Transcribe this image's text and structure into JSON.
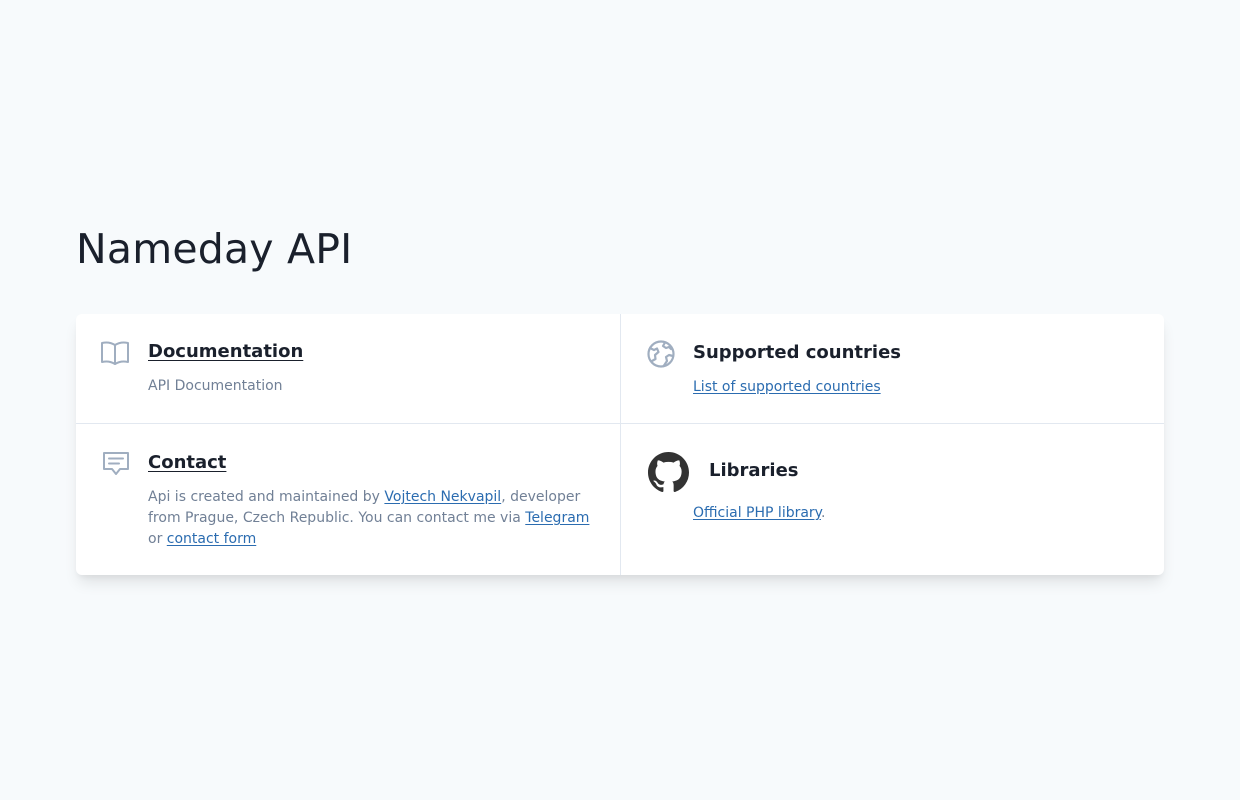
{
  "page": {
    "title": "Nameday API"
  },
  "cards": {
    "documentation": {
      "icon": "book-icon",
      "title": "Documentation",
      "description": "API Documentation"
    },
    "countries": {
      "icon": "globe-icon",
      "title": "Supported countries",
      "link": "List of supported countries"
    },
    "contact": {
      "icon": "chat-icon",
      "title": "Contact",
      "text_before": "Api is created and maintained by ",
      "author_link": "Vojtech Nekvapil",
      "text_middle": ", developer from Prague, Czech Republic. You can contact me via ",
      "telegram_link": "Telegram",
      "text_or": " or ",
      "contact_form_link": "contact form"
    },
    "libraries": {
      "icon": "github-icon",
      "title": "Libraries",
      "php_link": "Official PHP library",
      "php_suffix": "."
    }
  },
  "colors": {
    "background": "#f7fafc",
    "card": "#ffffff",
    "heading": "#1a202c",
    "muted": "#718096",
    "link": "#2b6cb0",
    "icon": "#a0aec0"
  }
}
